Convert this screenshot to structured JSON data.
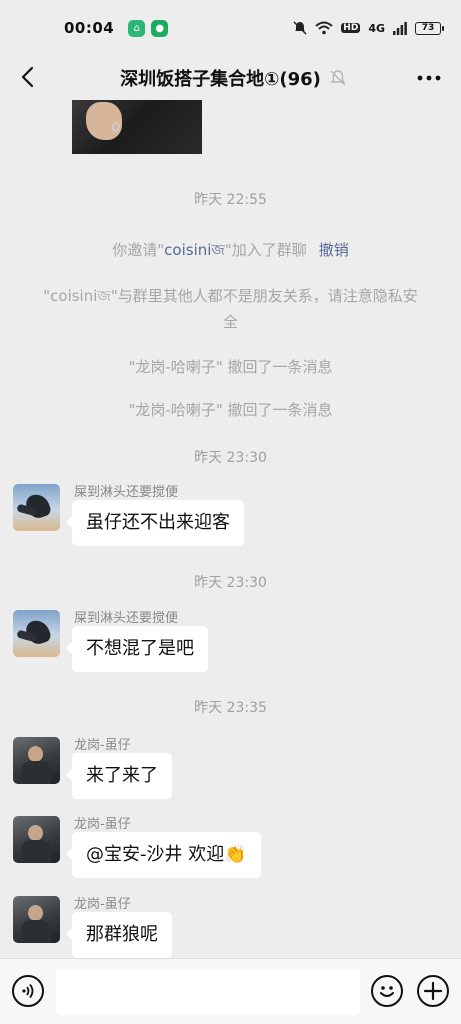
{
  "status": {
    "time": "00:04",
    "hd": "HD",
    "network": "4G",
    "battery": "73"
  },
  "header": {
    "title": "深圳饭搭子集合地①(96)"
  },
  "chat": {
    "system": {
      "time1": "昨天 22:55",
      "invite_prefix": "你邀请\"",
      "invite_name": "coisiniজ",
      "invite_suffix": "\"加入了群聊",
      "invite_action": "撤销",
      "notice": "\"coisiniজ\"与群里其他人都不是朋友关系，请注意隐私安全",
      "recall1": "\"龙岗-哈喇子\" 撤回了一条消息",
      "recall2": "\"龙岗-哈喇子\" 撤回了一条消息",
      "time2": "昨天 23:30",
      "time3": "昨天 23:30",
      "time4": "昨天 23:35"
    },
    "messages": [
      {
        "sender": "屎到淋头还要搅便",
        "text": "虽仔还不出来迎客"
      },
      {
        "sender": "屎到淋头还要搅便",
        "text": "不想混了是吧"
      },
      {
        "sender": "龙岗-虽仔",
        "text": "来了来了"
      },
      {
        "sender": "龙岗-虽仔",
        "text": "@宝安-沙井  欢迎👏"
      },
      {
        "sender": "龙岗-虽仔",
        "text": "那群狼呢"
      }
    ]
  },
  "input": {
    "placeholder": ""
  }
}
